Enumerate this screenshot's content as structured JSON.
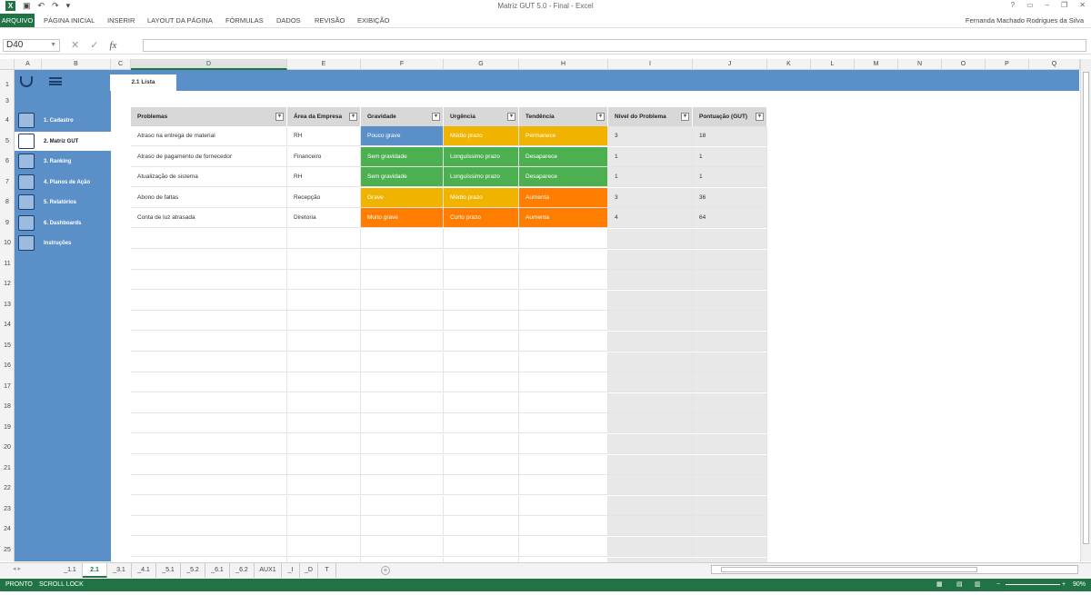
{
  "window": {
    "title": "Matriz GUT 5.0 - Final - Excel",
    "user": "Fernanda Machado Rodrigues da Silva"
  },
  "ribbon_tabs": [
    "ARQUIVO",
    "PÁGINA INICIAL",
    "INSERIR",
    "LAYOUT DA PÁGINA",
    "FÓRMULAS",
    "DADOS",
    "REVISÃO",
    "EXIBIÇÃO"
  ],
  "formula_bar": {
    "name_box": "D40",
    "fx": "fx",
    "value": ""
  },
  "columns": [
    "A",
    "B",
    "C",
    "D",
    "E",
    "F",
    "G",
    "H",
    "I",
    "J",
    "K",
    "L",
    "M",
    "N",
    "O",
    "P",
    "Q"
  ],
  "rows": [
    "1",
    "3",
    "4",
    "5",
    "6",
    "7",
    "8",
    "9",
    "10",
    "11",
    "12",
    "13",
    "14",
    "15",
    "16",
    "17",
    "18",
    "19",
    "20",
    "21",
    "22",
    "23",
    "24",
    "25"
  ],
  "sheet_header_tab": "2.1 Lista",
  "sidebar": {
    "items": [
      {
        "label": "1. Cadastro",
        "icon": "clipboard-icon"
      },
      {
        "label": "2. Matriz GUT",
        "icon": "alarm-icon"
      },
      {
        "label": "3. Ranking",
        "icon": "bar-chart-icon"
      },
      {
        "label": "4. Planos de Ação",
        "icon": "checklist-icon"
      },
      {
        "label": "5. Relatórios",
        "icon": "report-icon"
      },
      {
        "label": "6. Dashboards",
        "icon": "dashboard-icon"
      },
      {
        "label": "Instruções",
        "icon": "instructions-icon"
      }
    ],
    "active_index": 1
  },
  "table": {
    "headers": [
      "Problemas",
      "Área da Empresa",
      "Gravidade",
      "Urgência",
      "Tendência",
      "Nível do Problema",
      "Pontuação (GUT)"
    ],
    "rows": [
      [
        "Atraso na entrega de material",
        "RH",
        "Pouco grave",
        "Médio prazo",
        "Permanece",
        "3",
        "18"
      ],
      [
        "Atraso de pagamento de fornecedor",
        "Financeiro",
        "Sem gravidade",
        "Longuíssimo prazo",
        "Desaparece",
        "1",
        "1"
      ],
      [
        "Atualização de sistema",
        "RH",
        "Sem gravidade",
        "Longuíssimo prazo",
        "Desaparece",
        "1",
        "1"
      ],
      [
        "Abono de faltas",
        "Recepção",
        "Grave",
        "Médio prazo",
        "Aumenta",
        "3",
        "36"
      ],
      [
        "Conta de luz atrasada",
        "Diretoria",
        "Muito grave",
        "Curto prazo",
        "Aumenta",
        "4",
        "64"
      ]
    ],
    "cell_colors": [
      [
        "#5b8fc7",
        "#f0b400",
        "#f0b400"
      ],
      [
        "#4caf50",
        "#4caf50",
        "#4caf50"
      ],
      [
        "#4caf50",
        "#4caf50",
        "#4caf50"
      ],
      [
        "#f0b400",
        "#f0b400",
        "#ff7d00"
      ],
      [
        "#ff7d00",
        "#ff7d00",
        "#ff7d00"
      ]
    ]
  },
  "sheet_tabs": [
    "_1.1",
    "2.1",
    "_3.1",
    "_4.1",
    "_5.1",
    "_5.2",
    "_6.1",
    "_6.2",
    "AUX1",
    "_I",
    "_D",
    "T"
  ],
  "active_sheet_tab": "2.1",
  "status": {
    "left": "PRONTO",
    "scroll_lock": "SCROLL LOCK",
    "zoom": "90%"
  },
  "colors": {
    "excel_green": "#217346",
    "sidebar_blue": "#5b8fc7"
  }
}
